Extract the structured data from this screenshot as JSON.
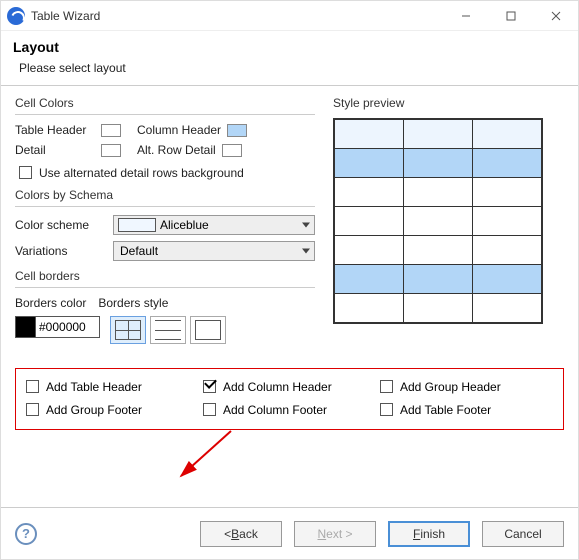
{
  "app_title": "Table Wizard",
  "header": {
    "title": "Layout",
    "subtitle": "Please select layout"
  },
  "cell_colors": {
    "group_label": "Cell Colors",
    "table_header_label": "Table Header",
    "column_header_label": "Column Header",
    "detail_label": "Detail",
    "alt_row_detail_label": "Alt. Row Detail",
    "alternated_label": "Use alternated detail rows background"
  },
  "schema": {
    "group_label": "Colors by Schema",
    "scheme_label": "Color scheme",
    "scheme_value": "Aliceblue",
    "variations_label": "Variations",
    "variations_value": "Default"
  },
  "borders": {
    "group_label": "Cell borders",
    "color_label": "Borders color",
    "style_label": "Borders style",
    "color_value": "#000000"
  },
  "preview_label": "Style preview",
  "footer_checks": {
    "add_table_header": "Add Table Header",
    "add_column_header": "Add Column Header",
    "add_group_header": "Add Group Header",
    "add_group_footer": "Add Group Footer",
    "add_column_footer": "Add Column Footer",
    "add_table_footer": "Add Table Footer"
  },
  "buttons": {
    "back": "< Back",
    "next": "Next >",
    "finish": "Finish",
    "cancel": "Cancel"
  }
}
